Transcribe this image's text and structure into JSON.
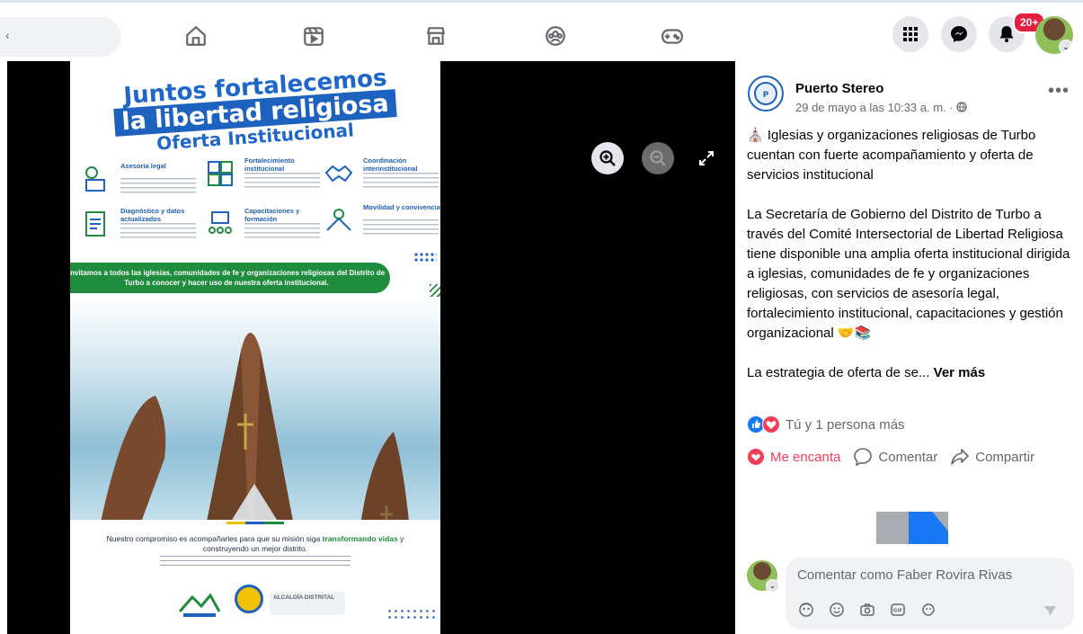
{
  "nav": {
    "search_text": "‹",
    "icons": [
      "home-icon",
      "watch-icon",
      "marketplace-icon",
      "groups-icon",
      "gaming-icon"
    ],
    "notification_badge": "20+"
  },
  "viewer": {
    "poster": {
      "title_line1": "Juntos fortalecemos",
      "title_line2": "la libertad religiosa",
      "title_line3": "Oferta Institucional",
      "services": [
        {
          "heading": "Asesoría legal"
        },
        {
          "heading": "Fortalecimiento institucional"
        },
        {
          "heading": "Coordinación interinstitucional"
        },
        {
          "heading": "Diagnóstico y datos actualizados"
        },
        {
          "heading": "Capacitaciones y formación"
        },
        {
          "heading": "Movilidad y convivencia"
        }
      ],
      "invite_text": "Invitamos a todos las iglesias, comunidades de fe y organizaciones religiosas del Distrito de Turbo a conocer y hacer uso de nuestra oferta institucional.",
      "commitment_pre": "Nuestro compromiso es acompañarles para que su misión siga ",
      "commitment_bold": "transformando vidas",
      "commitment_post": " y construyendo un mejor distrito.",
      "logo_text": "ALCALDÍA DISTRITAL"
    }
  },
  "post": {
    "page_name": "Puerto Stereo",
    "meta": "29 de mayo a las 10:33 a. m. · ",
    "more_label": "•••",
    "paragraph1": "⛪ Iglesias y organizaciones religiosas de Turbo cuentan con fuerte acompañamiento y oferta de servicios institucional",
    "paragraph2": "La Secretaría de Gobierno del Distrito de Turbo a través del Comité Intersectorial de Libertad Religiosa tiene disponible una amplia oferta institucional dirigida a iglesias, comunidades de fe y organizaciones religiosas, con servicios de asesoría legal, fortalecimiento institucional, capacitaciones y gestión organizacional 🤝📚",
    "paragraph3": "La estrategia de oferta de se... ",
    "see_more": "Ver más",
    "reactions_text": "Tú y 1 persona más",
    "actions": {
      "love": "Me encanta",
      "comment": "Comentar",
      "share": "Compartir"
    },
    "comment_placeholder": "Comentar como Faber Rovira Rivas"
  },
  "colors": {
    "brand_blue": "#1877f2",
    "love_red": "#f33e58",
    "badge_red": "#e41e3f"
  }
}
